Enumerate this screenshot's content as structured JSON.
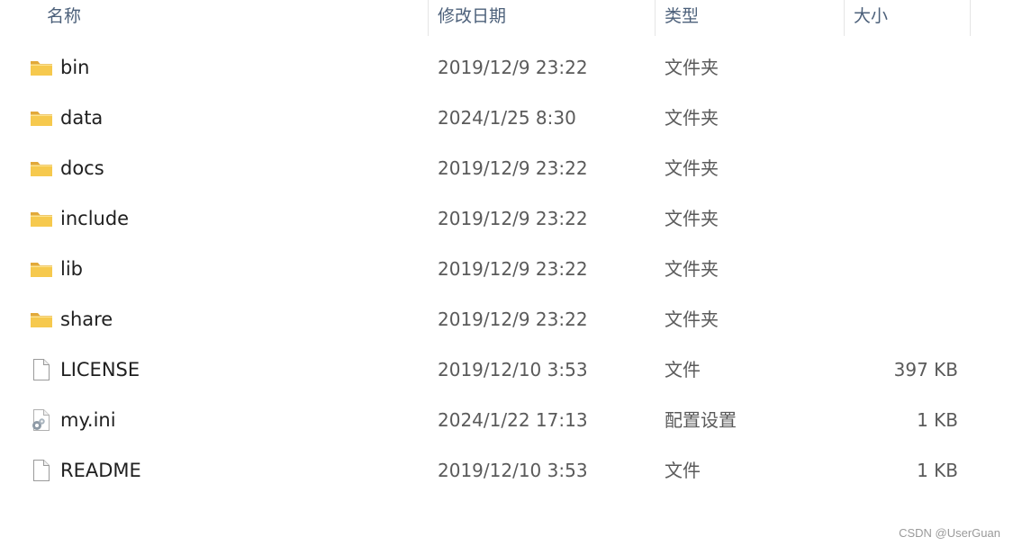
{
  "columns": {
    "name": "名称",
    "modified": "修改日期",
    "type": "类型",
    "size": "大小"
  },
  "files": [
    {
      "name": "bin",
      "modified": "2019/12/9 23:22",
      "type": "文件夹",
      "size": "",
      "icon": "folder-icon"
    },
    {
      "name": "data",
      "modified": "2024/1/25 8:30",
      "type": "文件夹",
      "size": "",
      "icon": "folder-icon"
    },
    {
      "name": "docs",
      "modified": "2019/12/9 23:22",
      "type": "文件夹",
      "size": "",
      "icon": "folder-icon"
    },
    {
      "name": "include",
      "modified": "2019/12/9 23:22",
      "type": "文件夹",
      "size": "",
      "icon": "folder-icon"
    },
    {
      "name": "lib",
      "modified": "2019/12/9 23:22",
      "type": "文件夹",
      "size": "",
      "icon": "folder-icon"
    },
    {
      "name": "share",
      "modified": "2019/12/9 23:22",
      "type": "文件夹",
      "size": "",
      "icon": "folder-icon"
    },
    {
      "name": "LICENSE",
      "modified": "2019/12/10 3:53",
      "type": "文件",
      "size": "397 KB",
      "icon": "file-icon"
    },
    {
      "name": "my.ini",
      "modified": "2024/1/22 17:13",
      "type": "配置设置",
      "size": "1 KB",
      "icon": "settings-file-icon"
    },
    {
      "name": "README",
      "modified": "2019/12/10 3:53",
      "type": "文件",
      "size": "1 KB",
      "icon": "file-icon"
    }
  ],
  "watermark": "CSDN @UserGuan",
  "colors": {
    "header_text": "#4c607a",
    "folder_yellow": "#f6c94e",
    "text_secondary": "#5a5a5a"
  }
}
